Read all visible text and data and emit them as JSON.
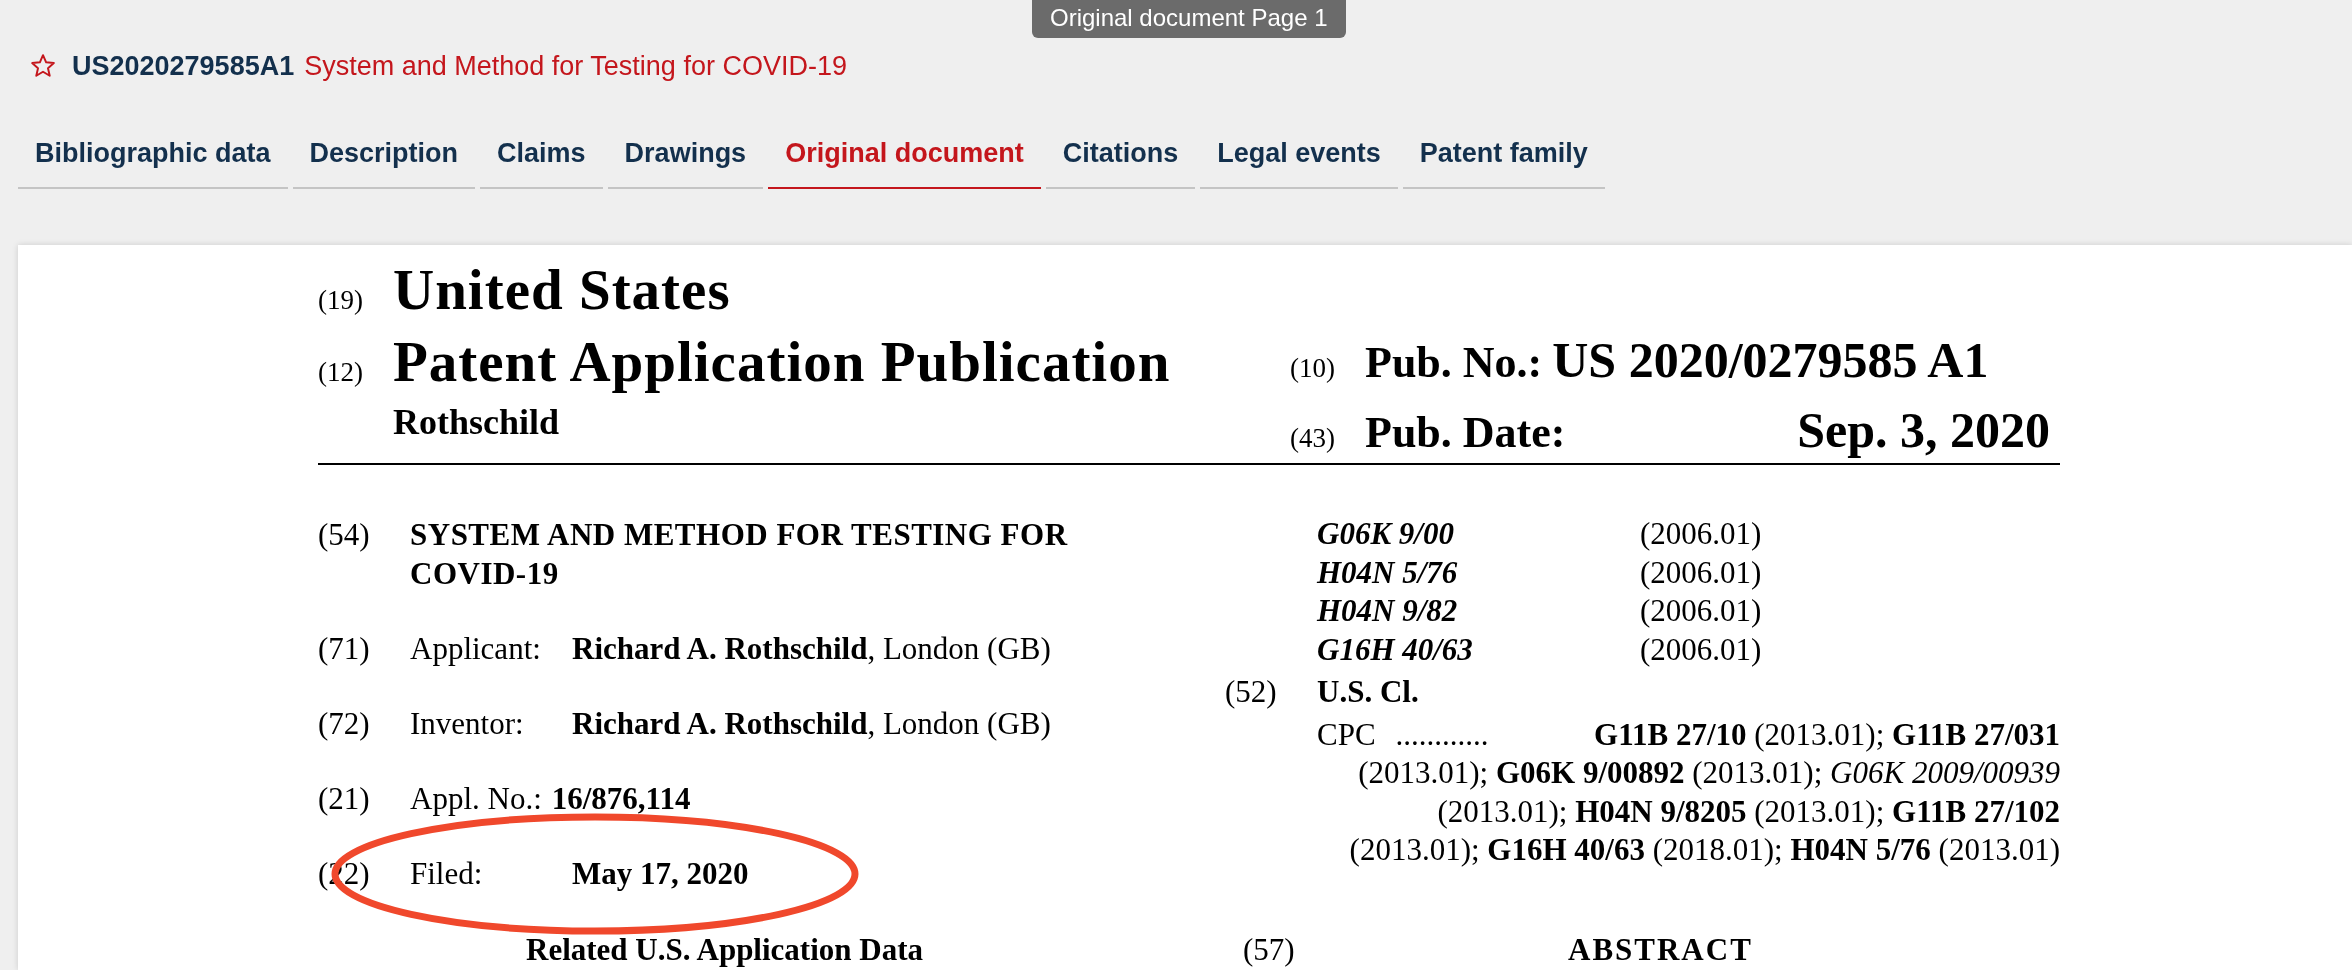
{
  "header": {
    "starred": false,
    "pub_number": "US2020279585A1",
    "title": "System and Method for Testing for COVID-19"
  },
  "page_tooltip": "Original document Page 1",
  "tabs": [
    {
      "label": "Bibliographic data",
      "selected": false
    },
    {
      "label": "Description",
      "selected": false
    },
    {
      "label": "Claims",
      "selected": false
    },
    {
      "label": "Drawings",
      "selected": false
    },
    {
      "label": "Original document",
      "selected": true
    },
    {
      "label": "Citations",
      "selected": false
    },
    {
      "label": "Legal events",
      "selected": false
    },
    {
      "label": "Patent family",
      "selected": false
    }
  ],
  "document": {
    "masthead": [
      {
        "code": "(19)",
        "text": "United States"
      },
      {
        "code": "(12)",
        "text": "Patent Application Publication"
      }
    ],
    "inventor_heading": "Rothschild",
    "pub_number": {
      "code": "(10)",
      "label": "Pub. No.:",
      "value": "US 2020/0279585 A1"
    },
    "pub_date": {
      "code": "(43)",
      "label": "Pub. Date:",
      "value": "Sep. 3, 2020"
    },
    "fields": [
      {
        "code": "(54)",
        "kind": "title",
        "value": "SYSTEM AND METHOD FOR TESTING FOR COVID-19",
        "circled": false
      },
      {
        "code": "(71)",
        "kind": "party",
        "label": "Applicant:",
        "value": "**Richard A. Rothschild**, London (GB)",
        "circled": false
      },
      {
        "code": "(72)",
        "kind": "party",
        "label": "Inventor:",
        "value": "**Richard A. Rothschild**, London (GB)",
        "circled": false
      },
      {
        "code": "(21)",
        "kind": "number",
        "label": "Appl. No.:",
        "value": "16/876,114",
        "circled": false
      },
      {
        "code": "(22)",
        "kind": "number",
        "label": "Filed:",
        "value": "May 17, 2020",
        "circled": true
      }
    ],
    "related_heading": "Related U.S. Application Data",
    "int_cl": [
      {
        "code": "G06K 9/00",
        "version": "(2006.01)"
      },
      {
        "code": "H04N 5/76",
        "version": "(2006.01)"
      },
      {
        "code": "H04N 9/82",
        "version": "(2006.01)"
      },
      {
        "code": "G16H 40/63",
        "version": "(2006.01)"
      }
    ],
    "us_cl": {
      "code": "(52)",
      "label": "U.S. Cl.",
      "cpc_label": "CPC",
      "cpc_dots": "............",
      "cpc_text": "**G11B 27/10** (2013.01); **G11B 27/031** (2013.01); **G06K 9/00892** (2013.01); *G06K 2009/00939* (2013.01); **H04N 9/8205** (2013.01); **G11B 27/102** (2013.01); **G16H 40/63** (2018.01); **H04N 5/76** (2013.01)"
    },
    "abstract": {
      "code": "(57)",
      "heading": "ABSTRACT"
    }
  }
}
